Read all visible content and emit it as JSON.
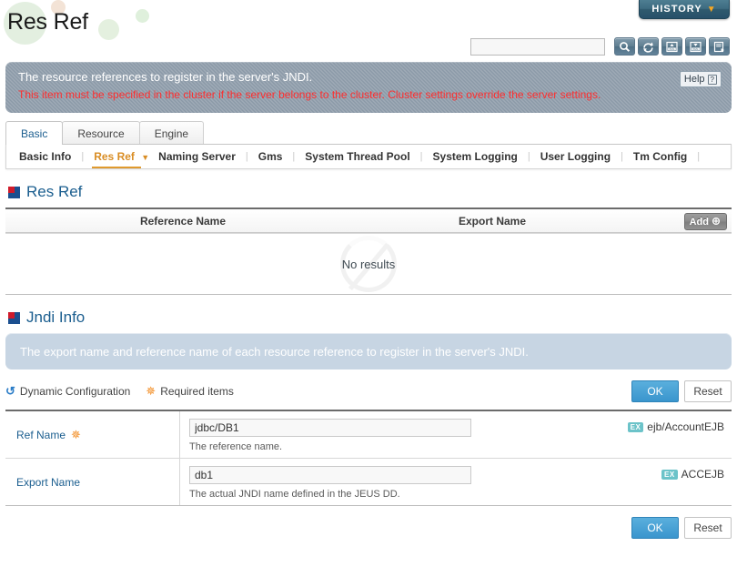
{
  "header": {
    "title": "Res Ref",
    "history_label": "HISTORY",
    "history_caret": "▼",
    "search_placeholder": "",
    "search_value": "",
    "toolbar_icons": [
      {
        "name": "search-icon",
        "title": "Search"
      },
      {
        "name": "refresh-icon",
        "title": "Refresh"
      },
      {
        "name": "xml-import-icon",
        "title": "Import XML"
      },
      {
        "name": "xml-export-icon",
        "title": "Export XML"
      },
      {
        "name": "document-export-icon",
        "title": "Export"
      }
    ]
  },
  "info_banner": {
    "line1": "The resource references to register in the server's JNDI.",
    "line2": "This item must be specified in the cluster if the server belongs to the cluster. Cluster settings override the server settings.",
    "help_label": "Help",
    "help_glyph": "?"
  },
  "tabs": [
    {
      "label": "Basic",
      "active": true
    },
    {
      "label": "Resource",
      "active": false
    },
    {
      "label": "Engine",
      "active": false
    }
  ],
  "subtabs": [
    {
      "label": "Basic Info",
      "active": false,
      "caret": ""
    },
    {
      "label": "Res Ref",
      "active": true,
      "caret": "▼"
    },
    {
      "label": "Naming Server",
      "active": false,
      "caret": ""
    },
    {
      "label": "Gms",
      "active": false,
      "caret": ""
    },
    {
      "label": "System Thread Pool",
      "active": false,
      "caret": ""
    },
    {
      "label": "System Logging",
      "active": false,
      "caret": ""
    },
    {
      "label": "User Logging",
      "active": false,
      "caret": ""
    },
    {
      "label": "Tm Config",
      "active": false,
      "caret": ""
    }
  ],
  "res_ref_section": {
    "title": "Res Ref",
    "columns": [
      "Reference Name",
      "Export Name"
    ],
    "add_label": "Add",
    "empty_message": "No results",
    "rows": []
  },
  "jndi_section": {
    "title": "Jndi Info",
    "banner": "The export name and reference name of each resource reference to register in the server's JNDI.",
    "legend_dynamic": "Dynamic Configuration",
    "legend_required": "Required items",
    "ok_label": "OK",
    "reset_label": "Reset",
    "fields": [
      {
        "label": "Ref Name",
        "required": true,
        "value": "jdbc/DB1",
        "placeholder": "",
        "hint": "The reference name.",
        "ex_badge": "EX",
        "ex_text": "ejb/AccountEJB"
      },
      {
        "label": "Export Name",
        "required": false,
        "value": "db1",
        "placeholder": "",
        "hint": "The actual JNDI name defined in the JEUS DD.",
        "ex_badge": "EX",
        "ex_text": "ACCEJB"
      }
    ],
    "footer_ok_label": "OK",
    "footer_reset_label": "Reset"
  },
  "colors": {
    "accent_blue": "#1b5e8f",
    "banner_gray": "#8c9aa8",
    "banner_light": "#c7d5e3",
    "warning_red": "#ff2d2d",
    "active_orange": "#d98d24",
    "ok_button": "#3a95cd",
    "ex_badge": "#6cc3c9"
  }
}
